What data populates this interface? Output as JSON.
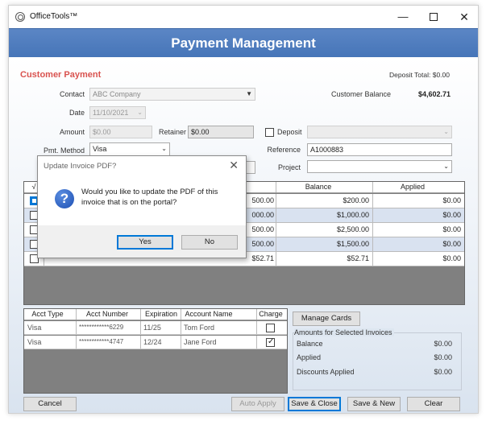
{
  "window": {
    "app_title": "OfficeTools™",
    "controls": {
      "minimize": "—",
      "close": "✕"
    }
  },
  "header": {
    "title": "Payment Management"
  },
  "form": {
    "section_title": "Customer Payment",
    "deposit_total": "Deposit Total: $0.00",
    "customer_balance_label": "Customer Balance",
    "customer_balance_value": "$4,602.71",
    "contact_label": "Contact",
    "contact_value": "ABC Company",
    "date_label": "Date",
    "date_value": "11/10/2021",
    "amount_label": "Amount",
    "amount_value": "$0.00",
    "retainer_label": "Retainer",
    "retainer_value": "$0.00",
    "deposit_label": "Deposit",
    "pmt_method_label": "Pmt. Method",
    "pmt_method_value": "Visa",
    "reference_label": "Reference",
    "reference_value": "A1000883",
    "project_label": "Project"
  },
  "invoice_grid": {
    "columns": [
      "√",
      "Balance",
      "Applied"
    ],
    "rows": [
      {
        "col_partial": "500.00",
        "balance": "$200.00",
        "applied": "$0.00",
        "selected": true
      },
      {
        "col_partial": "000.00",
        "balance": "$1,000.00",
        "applied": "$0.00",
        "selected": false
      },
      {
        "col_partial": "500.00",
        "balance": "$2,500.00",
        "applied": "$0.00",
        "selected": false
      },
      {
        "col_partial": "500.00",
        "balance": "$1,500.00",
        "applied": "$0.00",
        "selected": false
      },
      {
        "col_partial": "$52.71",
        "balance": "$52.71",
        "applied": "$0.00",
        "selected": false
      }
    ]
  },
  "dialog": {
    "title": "Update Invoice PDF?",
    "close": "✕",
    "message": "Would you like to update the PDF of this invoice that is on the portal?",
    "icon": "question-icon",
    "yes_label": "Yes",
    "no_label": "No"
  },
  "accounts": {
    "columns": [
      "Acct Type",
      "Acct Number",
      "Expiration",
      "Account Name",
      "Charge"
    ],
    "rows": [
      {
        "type": "Visa",
        "number": "************6229",
        "expiration": "11/25",
        "name": "Tom Ford",
        "charge": false
      },
      {
        "type": "Visa",
        "number": "************4747",
        "expiration": "12/24",
        "name": "Jane Ford",
        "charge": true
      }
    ]
  },
  "manage_cards_label": "Manage Cards",
  "amounts": {
    "title": "Amounts for Selected Invoices",
    "balance_label": "Balance",
    "balance_value": "$0.00",
    "applied_label": "Applied",
    "applied_value": "$0.00",
    "discounts_label": "Discounts Applied",
    "discounts_value": "$0.00"
  },
  "footer": {
    "cancel_label": "Cancel",
    "auto_apply_label": "Auto Apply",
    "save_close_label": "Save & Close",
    "save_new_label": "Save & New",
    "clear_label": "Clear"
  },
  "colors": {
    "header_blue": "#4f7cbf",
    "section_red": "#d9534f",
    "focus_blue": "#0078d7"
  }
}
